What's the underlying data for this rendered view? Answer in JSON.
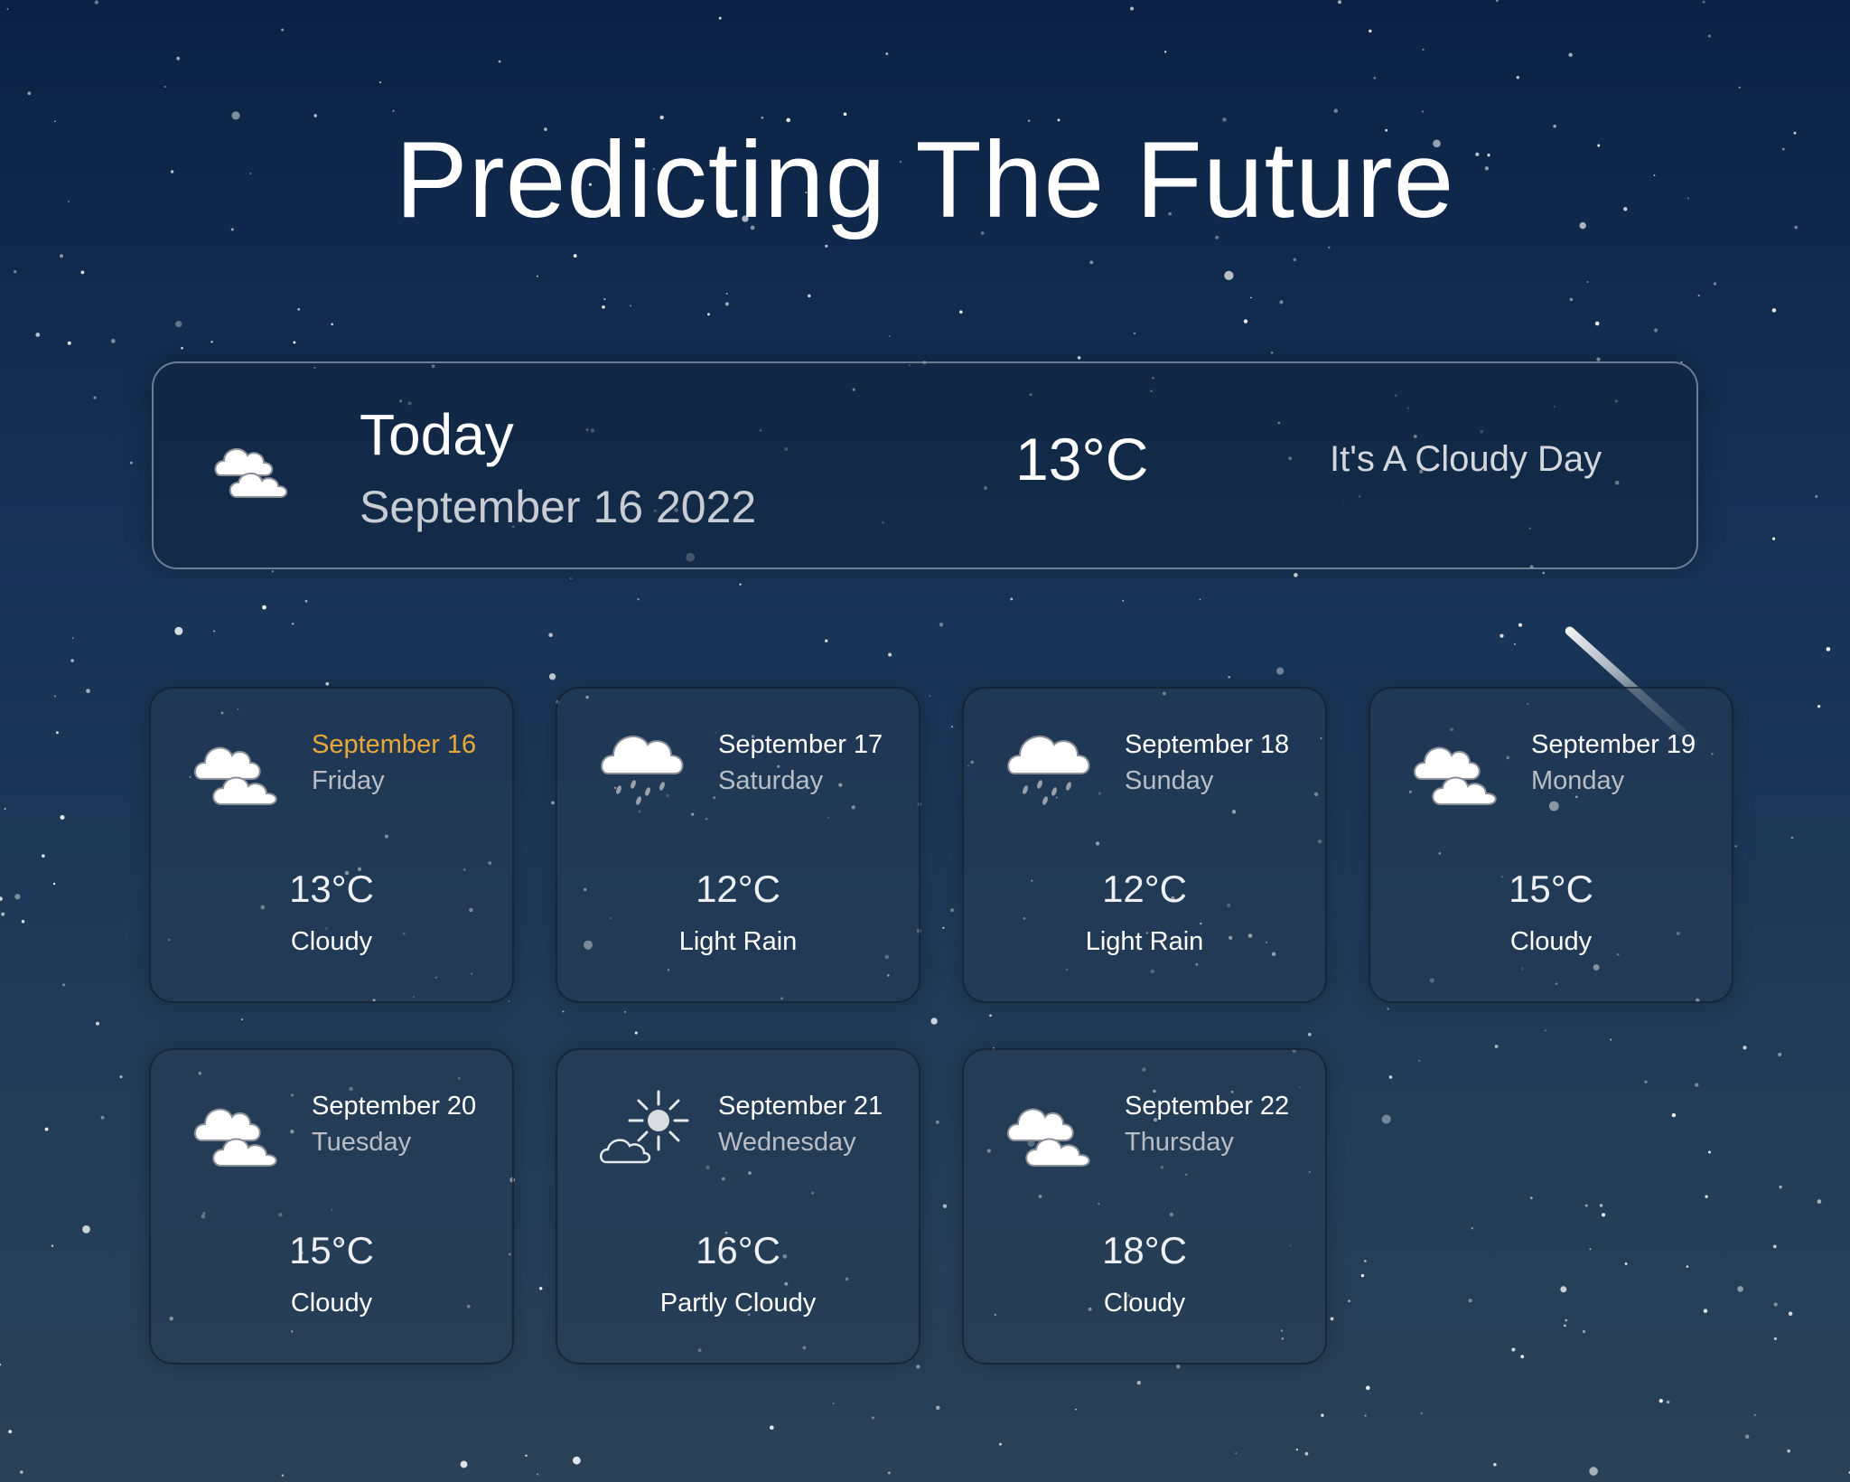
{
  "header": {
    "title": "Predicting The Future"
  },
  "today": {
    "label": "Today",
    "date": "September 16 2022",
    "temperature": "13°C",
    "description": "It's A Cloudy Day",
    "icon": "cloudy-icon"
  },
  "forecast": [
    {
      "date": "September 16",
      "weekday": "Friday",
      "temperature": "13°C",
      "condition": "Cloudy",
      "icon": "cloudy-icon",
      "highlight": true
    },
    {
      "date": "September 17",
      "weekday": "Saturday",
      "temperature": "12°C",
      "condition": "Light Rain",
      "icon": "rain-icon",
      "highlight": false
    },
    {
      "date": "September 18",
      "weekday": "Sunday",
      "temperature": "12°C",
      "condition": "Light Rain",
      "icon": "rain-icon",
      "highlight": false
    },
    {
      "date": "September 19",
      "weekday": "Monday",
      "temperature": "15°C",
      "condition": "Cloudy",
      "icon": "cloudy-icon",
      "highlight": false
    },
    {
      "date": "September 20",
      "weekday": "Tuesday",
      "temperature": "15°C",
      "condition": "Cloudy",
      "icon": "cloudy-icon",
      "highlight": false
    },
    {
      "date": "September 21",
      "weekday": "Wednesday",
      "temperature": "16°C",
      "condition": "Partly Cloudy",
      "icon": "partly-cloudy-icon",
      "highlight": false
    },
    {
      "date": "September 22",
      "weekday": "Thursday",
      "temperature": "18°C",
      "condition": "Cloudy",
      "icon": "cloudy-icon",
      "highlight": false
    }
  ],
  "colors": {
    "highlight": "#e8a83a",
    "background_top": "#0b2244",
    "background_bottom": "#2a4157"
  }
}
